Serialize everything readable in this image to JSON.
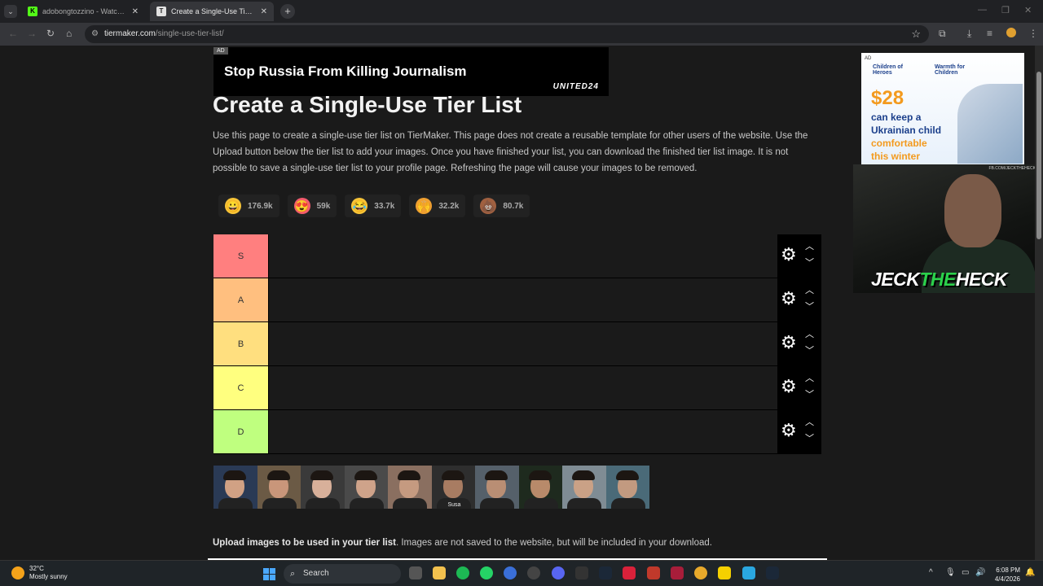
{
  "browser": {
    "tabs": [
      {
        "title": "adobongtozzino - Watch the V",
        "favicon": "K",
        "active": false
      },
      {
        "title": "Create a Single-Use Tier List (F",
        "favicon": "T",
        "active": true
      }
    ],
    "url_host": "tiermaker.com",
    "url_path": "/single-use-tier-list/"
  },
  "ad_banner": {
    "tag": "AD",
    "text": "Stop Russia From Killing Journalism",
    "brand": "UNITED24"
  },
  "page": {
    "title": "Create a Single-Use Tier List",
    "description": "Use this page to create a single-use tier list on TierMaker. This page does not create a reusable template for other users of the website. Use the Upload button below the tier list to add your images. Once you have finished your list, you can download the finished tier list image. It is not possible to save a single-use tier list to your profile page. Refreshing the page will cause your images to be removed.",
    "reactions": [
      {
        "icon": "grin-emoji-icon",
        "glyph": "😀",
        "count": "176.9k",
        "color": "#f7c437"
      },
      {
        "icon": "heart-eyes-emoji-icon",
        "glyph": "😍",
        "count": "59k",
        "color": "#f45b6c"
      },
      {
        "icon": "laughing-emoji-icon",
        "glyph": "😂",
        "count": "33.7k",
        "color": "#f7c437"
      },
      {
        "icon": "praise-hands-emoji-icon",
        "glyph": "🙌",
        "count": "32.2k",
        "color": "#f0a030"
      },
      {
        "icon": "poop-emoji-icon",
        "glyph": "💩",
        "count": "80.7k",
        "color": "#a06040"
      }
    ],
    "tiers": [
      {
        "label": "S",
        "color": "#ff7f7f"
      },
      {
        "label": "A",
        "color": "#ffbf7f"
      },
      {
        "label": "B",
        "color": "#ffdf7f"
      },
      {
        "label": "C",
        "color": "#ffff7f"
      },
      {
        "label": "D",
        "color": "#bfff7f"
      }
    ],
    "pool_images": [
      {
        "bg": "#2a3a55",
        "skin": "#d1a184",
        "caption": ""
      },
      {
        "bg": "#6b5a45",
        "skin": "#c9967a",
        "caption": ""
      },
      {
        "bg": "#3a3a3a",
        "skin": "#d8b09a",
        "caption": ""
      },
      {
        "bg": "#4a4a4a",
        "skin": "#cfa38a",
        "caption": ""
      },
      {
        "bg": "#8a6f60",
        "skin": "#c59a80",
        "caption": ""
      },
      {
        "bg": "#2e2e2e",
        "skin": "#a87c62",
        "caption": "Susa"
      },
      {
        "bg": "#55606a",
        "skin": "#b98e74",
        "caption": ""
      },
      {
        "bg": "#1e2a1e",
        "skin": "#b88a6a",
        "caption": ""
      },
      {
        "bg": "#7f8c94",
        "skin": "#caa186",
        "caption": ""
      },
      {
        "bg": "#4a6a78",
        "skin": "#c29a80",
        "caption": ""
      }
    ],
    "upload_bold": "Upload images to be used in your tier list",
    "upload_rest": ". Images are not saved to the website, but will be included in your download."
  },
  "side_ad": {
    "tag": "AD",
    "org1": "Children of Heroes",
    "org2": "Warmth for Children",
    "price": "$28",
    "lines": [
      "can keep a",
      "Ukrainian child",
      "comfortable",
      "this winter"
    ]
  },
  "webcam": {
    "brand_a": "JECK",
    "brand_b": "THE",
    "brand_c": "HECK",
    "tagline": "FB.COM/JECKTHEHECK"
  },
  "taskbar": {
    "temp": "32°C",
    "weather": "Mostly sunny",
    "search": "Search",
    "time": "6:08 PM",
    "date": "4/4/2026"
  }
}
